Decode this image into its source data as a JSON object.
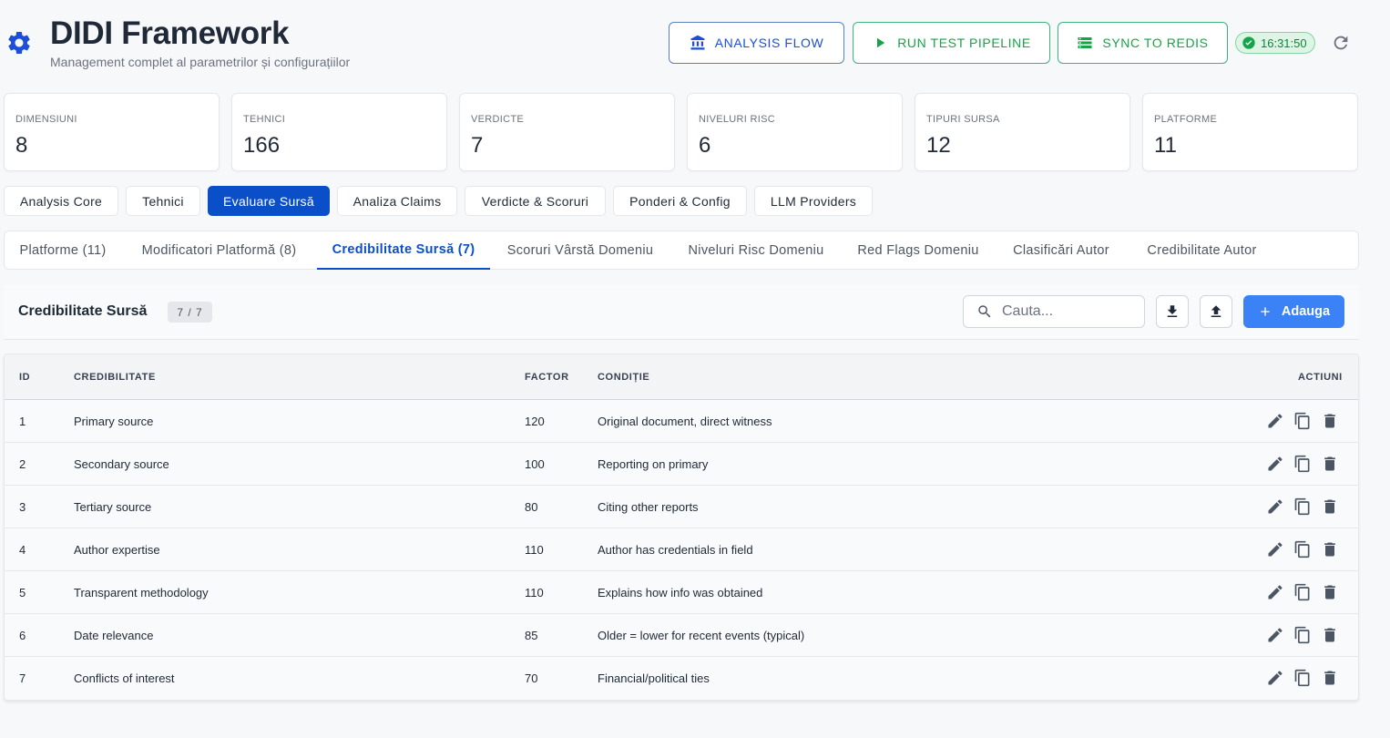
{
  "header": {
    "title": "DIDI Framework",
    "subtitle": "Management complet al parametrilor și configurațiilor",
    "buttons": {
      "analysis_flow": "ANALYSIS FLOW",
      "run_test_pipeline": "RUN TEST PIPELINE",
      "sync_to_redis": "SYNC TO REDIS"
    },
    "time": "16:31:50"
  },
  "stats": [
    {
      "label": "DIMENSIUNI",
      "value": "8"
    },
    {
      "label": "TEHNICI",
      "value": "166"
    },
    {
      "label": "VERDICTE",
      "value": "7"
    },
    {
      "label": "NIVELURI RISC",
      "value": "6"
    },
    {
      "label": "TIPURI SURSA",
      "value": "12"
    },
    {
      "label": "PLATFORME",
      "value": "11"
    }
  ],
  "main_tabs": [
    {
      "label": "Analysis Core"
    },
    {
      "label": "Tehnici"
    },
    {
      "label": "Evaluare Sursă"
    },
    {
      "label": "Analiza Claims"
    },
    {
      "label": "Verdicte & Scoruri"
    },
    {
      "label": "Ponderi & Config"
    },
    {
      "label": "LLM Providers"
    }
  ],
  "sub_tabs": [
    {
      "label": "Platforme (11)"
    },
    {
      "label": "Modificatori Platformă (8)"
    },
    {
      "label": "Credibilitate Sursă (7)"
    },
    {
      "label": "Scoruri Vârstă Domeniu"
    },
    {
      "label": "Niveluri Risc Domeniu"
    },
    {
      "label": "Red Flags Domeniu"
    },
    {
      "label": "Clasificări Autor"
    },
    {
      "label": "Credibilitate Autor"
    }
  ],
  "panel": {
    "title": "Credibilitate Sursă",
    "count": "7 / 7",
    "search_placeholder": "Cauta...",
    "add_label": "Adauga"
  },
  "table": {
    "columns": {
      "id": "ID",
      "credibility": "CREDIBILITATE",
      "factor": "FACTOR",
      "condition": "CONDIȚIE",
      "actions": "ACTIUNI"
    },
    "rows": [
      {
        "id": "1",
        "credibility": "Primary source",
        "factor": "120",
        "condition": "Original document, direct witness"
      },
      {
        "id": "2",
        "credibility": "Secondary source",
        "factor": "100",
        "condition": "Reporting on primary"
      },
      {
        "id": "3",
        "credibility": "Tertiary source",
        "factor": "80",
        "condition": "Citing other reports"
      },
      {
        "id": "4",
        "credibility": "Author expertise",
        "factor": "110",
        "condition": "Author has credentials in field"
      },
      {
        "id": "5",
        "credibility": "Transparent methodology",
        "factor": "110",
        "condition": "Explains how info was obtained"
      },
      {
        "id": "6",
        "credibility": "Date relevance",
        "factor": "85",
        "condition": "Older = lower for recent events (typical)"
      },
      {
        "id": "7",
        "credibility": "Conflicts of interest",
        "factor": "70",
        "condition": "Financial/political ties"
      }
    ]
  },
  "icons": {
    "logo": "gear-icon",
    "analysis_flow": "bank-icon",
    "run_test_pipeline": "play-icon",
    "sync_to_redis": "storage-icon",
    "time": "check-circle-icon",
    "refresh": "refresh-icon",
    "search": "search-icon",
    "download": "download-icon",
    "upload": "upload-icon",
    "add": "plus-icon",
    "edit": "pencil-icon",
    "copy": "copy-icon",
    "delete": "trash-icon"
  },
  "colors": {
    "primary": "#0b4fc8",
    "accent_blue": "#3b82f6",
    "green": "#16a34a",
    "background": "#f7f8fa"
  }
}
